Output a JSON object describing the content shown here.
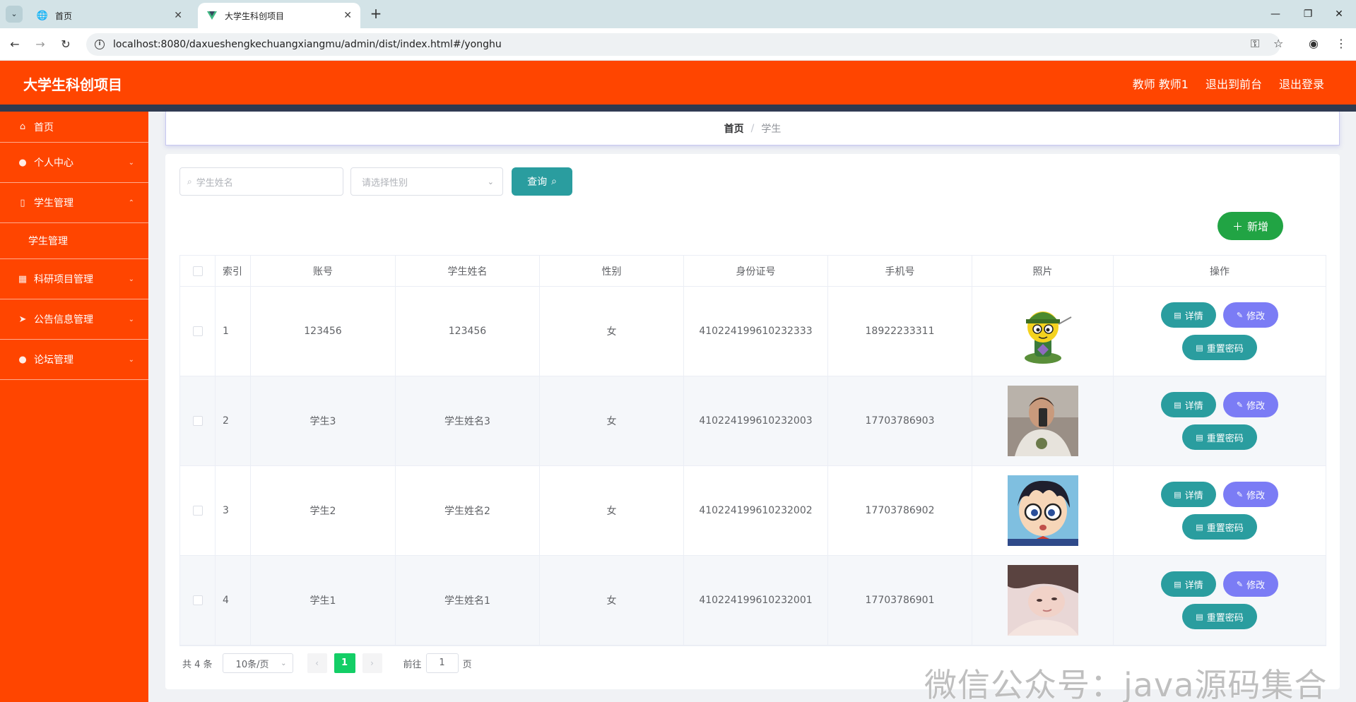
{
  "browser": {
    "tabs": [
      {
        "title": "首页",
        "active": false
      },
      {
        "title": "大学生科创项目",
        "active": true
      }
    ],
    "url": "localhost:8080/daxueshengkechuangxiangmu/admin/dist/index.html#/yonghu"
  },
  "header": {
    "title": "大学生科创项目",
    "user": "教师 教师1",
    "to_frontend": "退出到前台",
    "logout": "退出登录"
  },
  "sidebar": {
    "items": [
      {
        "label": "首页",
        "icon": "home-icon"
      },
      {
        "label": "个人中心",
        "icon": "user-icon"
      },
      {
        "label": "学生管理",
        "icon": "phone-icon"
      },
      {
        "label": "学生管理",
        "icon": ""
      },
      {
        "label": "科研项目管理",
        "icon": "grid-icon"
      },
      {
        "label": "公告信息管理",
        "icon": "send-icon"
      },
      {
        "label": "论坛管理",
        "icon": "user-icon"
      }
    ]
  },
  "breadcrumb": {
    "home": "首页",
    "separator": "/",
    "current": "学生"
  },
  "search": {
    "name_placeholder": "学生姓名",
    "gender_placeholder": "请选择性别",
    "query_label": "查询",
    "add_label": "新增"
  },
  "table": {
    "headers": [
      "索引",
      "账号",
      "学生姓名",
      "性别",
      "身份证号",
      "手机号",
      "照片",
      "操作"
    ],
    "rows": [
      {
        "index": "1",
        "account": "123456",
        "name": "123456",
        "gender": "女",
        "id_number": "410224199610232333",
        "phone": "18922233311",
        "photo": "cartoon-avatar"
      },
      {
        "index": "2",
        "account": "学生3",
        "name": "学生姓名3",
        "gender": "女",
        "id_number": "410224199610232003",
        "phone": "17703786903",
        "photo": "selfie-photo"
      },
      {
        "index": "3",
        "account": "学生2",
        "name": "学生姓名2",
        "gender": "女",
        "id_number": "410224199610232002",
        "phone": "17703786902",
        "photo": "conan-cartoon"
      },
      {
        "index": "4",
        "account": "学生1",
        "name": "学生姓名1",
        "gender": "女",
        "id_number": "410224199610232001",
        "phone": "17703786901",
        "photo": "portrait-photo"
      }
    ],
    "actions": {
      "detail": "详情",
      "edit": "修改",
      "reset": "重置密码"
    }
  },
  "pagination": {
    "total": "共 4 条",
    "page_size": "10条/页",
    "current_page": "1",
    "goto_prefix": "前往",
    "goto_value": "1",
    "goto_suffix": "页"
  },
  "watermark": "微信公众号：java源码集合",
  "colors": {
    "header": "#ff4500",
    "sidebar": "#ff4500",
    "primary_teal": "#2a9d9f",
    "edit_purple": "#7b7cf5",
    "add_green": "#21a444",
    "page_active": "#13ce66"
  }
}
